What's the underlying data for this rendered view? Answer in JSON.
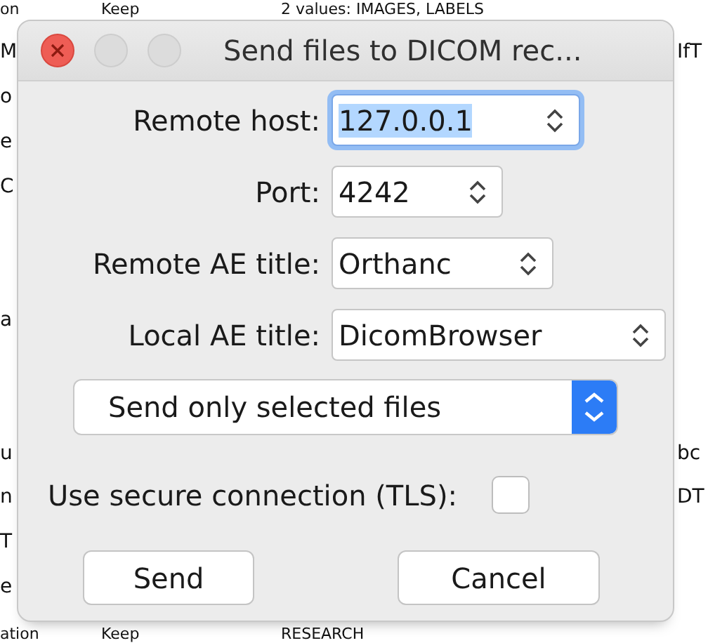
{
  "background_table": {
    "rows": [
      {
        "column_1": "on",
        "column_2": "Keep",
        "column_3": "2 values: IMAGES, LABELS"
      },
      {
        "column_1": "M",
        "column_4": "IfT"
      },
      {
        "column_1": "o"
      },
      {
        "column_1": "e"
      },
      {
        "column_1": "C"
      },
      {},
      {},
      {
        "column_1": "a"
      },
      {},
      {},
      {
        "column_1": "u",
        "column_4": "bc"
      },
      {
        "column_1": "n",
        "column_4": "DT"
      },
      {
        "column_1": "T"
      },
      {
        "column_1": "e"
      },
      {
        "column_1": "ation",
        "column_2": "Keep",
        "column_3": "RESEARCH"
      }
    ]
  },
  "dialog": {
    "title": "Send files to DICOM rec...",
    "fields": [
      {
        "label": "Remote host:",
        "value": "127.0.0.1",
        "focused": true
      },
      {
        "label": "Port:",
        "value": "4242",
        "focused": false
      },
      {
        "label": "Remote AE title:",
        "value": "Orthanc",
        "focused": false
      },
      {
        "label": "Local AE title:",
        "value": "DicomBrowser",
        "focused": false
      }
    ],
    "send_mode": {
      "value": "Send only selected files"
    },
    "tls": {
      "label": "Use secure connection (TLS):",
      "checked": false
    },
    "buttons": [
      "Send",
      "Cancel"
    ]
  }
}
